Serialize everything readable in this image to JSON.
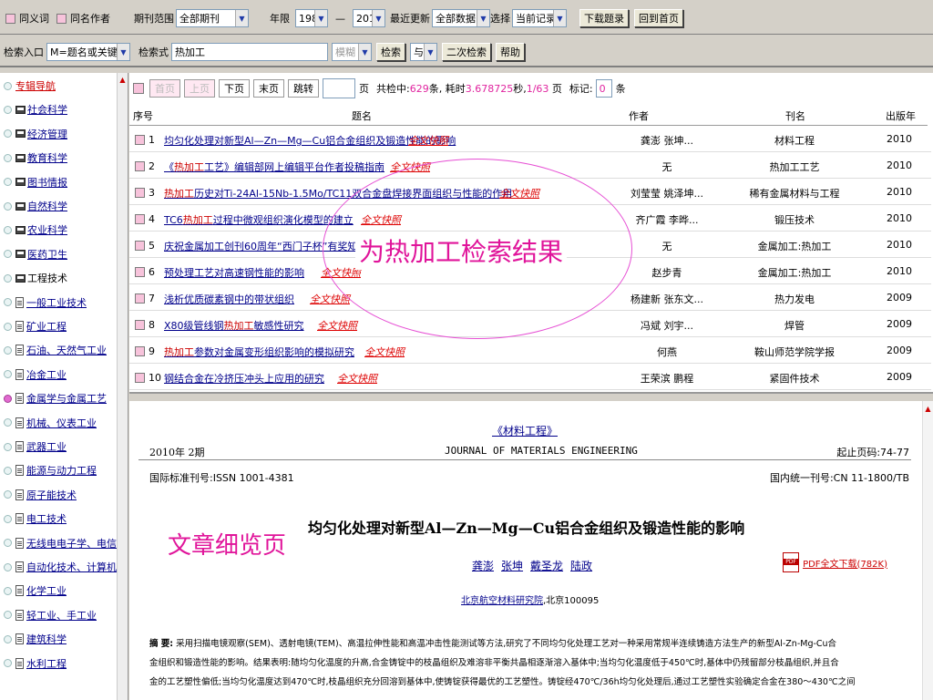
{
  "topbar": {
    "same_word": "同义词",
    "same_author": "同名作者",
    "journal_range_label": "期刊范围",
    "journal_range_value": "全部期刊",
    "year_label": "年限",
    "year_from": "1989",
    "year_dash": "—",
    "year_to": "2010",
    "update_label": "最近更新",
    "update_value": "全部数据",
    "select_label": "选择",
    "select_value": "当前记录",
    "download_btn": "下载题录",
    "home_btn": "回到首页"
  },
  "search": {
    "entry_label": "检索入口",
    "entry_value": "M=题名或关键词",
    "query_label": "检索式",
    "query_value": "热加工",
    "fuzzy_value": "模糊",
    "search_btn": "检索",
    "logic_value": "与",
    "secondary_btn": "二次检索",
    "help_btn": "帮助"
  },
  "sidebar": {
    "items": [
      {
        "label": "专辑导航",
        "kind": "none",
        "active": false,
        "red": true
      },
      {
        "label": "社会科学",
        "kind": "folder",
        "active": false
      },
      {
        "label": "经济管理",
        "kind": "folder",
        "active": false
      },
      {
        "label": "教育科学",
        "kind": "folder",
        "active": false
      },
      {
        "label": "图书情报",
        "kind": "folder",
        "active": false
      },
      {
        "label": "自然科学",
        "kind": "folder",
        "active": false
      },
      {
        "label": "农业科学",
        "kind": "folder",
        "active": false
      },
      {
        "label": "医药卫生",
        "kind": "folder",
        "active": false
      },
      {
        "label": "工程技术",
        "kind": "folder-open",
        "active": false
      },
      {
        "label": "一般工业技术",
        "kind": "doc",
        "active": false
      },
      {
        "label": "矿业工程",
        "kind": "doc",
        "active": false
      },
      {
        "label": "石油、天然气工业",
        "kind": "doc",
        "active": false
      },
      {
        "label": "冶金工业",
        "kind": "doc",
        "active": false
      },
      {
        "label": "金属学与金属工艺",
        "kind": "doc",
        "active": true
      },
      {
        "label": "机械、仪表工业",
        "kind": "doc",
        "active": false
      },
      {
        "label": "武器工业",
        "kind": "doc",
        "active": false
      },
      {
        "label": "能源与动力工程",
        "kind": "doc",
        "active": false
      },
      {
        "label": "原子能技术",
        "kind": "doc",
        "active": false
      },
      {
        "label": "电工技术",
        "kind": "doc",
        "active": false
      },
      {
        "label": "无线电电子学、电信",
        "kind": "doc",
        "active": false
      },
      {
        "label": "自动化技术、计算机",
        "kind": "doc",
        "active": false
      },
      {
        "label": "化学工业",
        "kind": "doc",
        "active": false
      },
      {
        "label": "轻工业、手工业",
        "kind": "doc",
        "active": false
      },
      {
        "label": "建筑科学",
        "kind": "doc",
        "active": false
      },
      {
        "label": "水利工程",
        "kind": "doc",
        "active": false
      }
    ]
  },
  "pager": {
    "first": "首页",
    "prev": "上页",
    "next": "下页",
    "last": "末页",
    "jump": "跳转",
    "page_suffix": "页",
    "found_prefix": "共检中:",
    "found_count": "629",
    "found_mid": "条, 耗时",
    "time": "3.678725",
    "time_unit": "秒,",
    "page_pos": "1/63",
    "page_unit": "页",
    "mark_label": "标记:",
    "mark_value": "0",
    "mark_unit": "条"
  },
  "table": {
    "headers": {
      "no": "序号",
      "title": "题名",
      "author": "作者",
      "journal": "刊名",
      "year": "出版年"
    },
    "fulltext_label": "全文快照",
    "rows": [
      {
        "no": "1",
        "pre": "均匀化处理对新型Al—Zn—Mg—Cu铝合金组织及锻造性能的影响",
        "hl": "",
        "post": "",
        "author": "龚澎 张坤...",
        "journal": "材料工程",
        "year": "2010"
      },
      {
        "no": "2",
        "pre": "《",
        "hl": "热加工",
        "post": "工艺》编辑部网上编辑平台作者投稿指南",
        "author": "无",
        "journal": "热加工工艺",
        "year": "2010"
      },
      {
        "no": "3",
        "pre": "",
        "hl": "热加工",
        "post": "历史对Ti-24Al-15Nb-1.5Mo/TC11双合金盘焊接界面组织与性能的作用",
        "author": "刘莹莹 姚泽坤...",
        "journal": "稀有金属材料与工程",
        "year": "2010"
      },
      {
        "no": "4",
        "pre": "TC6",
        "hl": "热加工",
        "post": "过程中微观组织演化模型的建立",
        "author": "齐广霞 李晔...",
        "journal": "锻压技术",
        "year": "2010"
      },
      {
        "no": "5",
        "pre": "庆祝金属加工创刊60周年“西门子杯”有奖知识竞赛",
        "hl": "",
        "post": "",
        "author": "无",
        "journal": "金属加工:热加工",
        "year": "2010"
      },
      {
        "no": "6",
        "pre": "预处理工艺对高速钢性能的影响",
        "hl": "",
        "post": "",
        "author": "赵步青",
        "journal": "金属加工:热加工",
        "year": "2010"
      },
      {
        "no": "7",
        "pre": "浅析优质碳素钢中的带状组织",
        "hl": "",
        "post": "",
        "author": "杨建新 张东文...",
        "journal": "热力发电",
        "year": "2009"
      },
      {
        "no": "8",
        "pre": "X80级管线钢",
        "hl": "热加工",
        "post": "敏感性研究",
        "author": "冯斌 刘宇...",
        "journal": "焊管",
        "year": "2009"
      },
      {
        "no": "9",
        "pre": "",
        "hl": "热加工",
        "post": "参数对金属变形组织影响的模拟研究",
        "author": "何燕",
        "journal": "鞍山师范学院学报",
        "year": "2009"
      },
      {
        "no": "10",
        "pre": "钢结合金在冷挤压冲头上应用的研究",
        "hl": "",
        "post": "",
        "author": "王荣滨 鹏程",
        "journal": "紧固件技术",
        "year": "2009"
      }
    ]
  },
  "callout_results": "为热加工检索结果",
  "detail": {
    "journal_cn": "《材料工程》",
    "issue": "2010年 2期",
    "journal_en": "JOURNAL OF MATERIALS ENGINEERING",
    "pages": "起止页码:74-77",
    "issn": "国际标准刊号:ISSN 1001-4381",
    "cn": "国内统一刊号:CN 11-1800/TB",
    "callout": "文章细览页",
    "title": "均匀化处理对新型Al—Zn—Mg—Cu铝合金组织及锻造性能的影响",
    "authors": [
      "龚澎",
      "张坤",
      "戴圣龙",
      "陆政"
    ],
    "affiliation_link": "北京航空材料研究院",
    "affiliation_post": ",北京100095",
    "pdf_label": "PDF全文下载(782K)",
    "abstract_label": "摘 要:",
    "abstract_1": "采用扫描电镜观察(SEM)、透射电镜(TEM)、高温拉伸性能和高温冲击性能测试等方法,研究了不同均匀化处理工艺对一种采用常规半连续铸造方法生产的新型Al-Zn-Mg-Cu合",
    "abstract_2": "金组织和锻造性能的影响。结果表明:随均匀化温度的升高,合金铸锭中的枝晶组织及难溶非平衡共晶相逐渐溶入基体中;当均匀化温度低于450℃时,基体中仍残留部分枝晶组织,并且合",
    "abstract_3": "金的工艺塑性偏低;当均匀化温度达到470℃时,枝晶组织充分回溶到基体中,使铸锭获得最优的工艺塑性。铸锭经470℃/36h均匀化处理后,通过工艺塑性实验确定合金在380～430℃之间"
  }
}
